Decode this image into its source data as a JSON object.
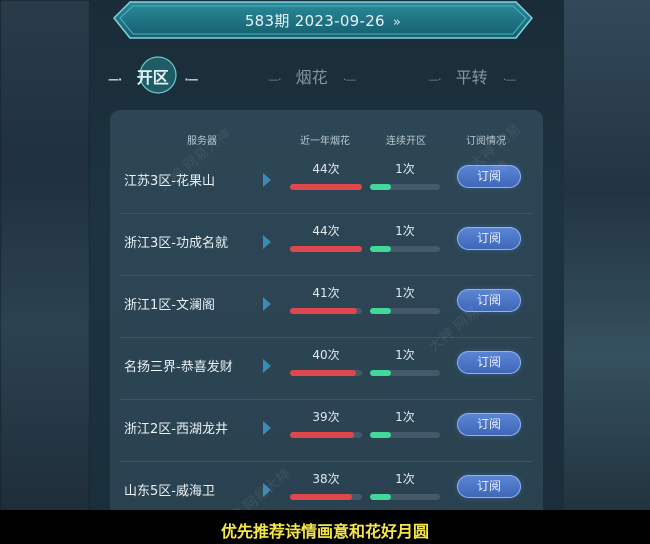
{
  "banner": {
    "label": "583期 2023-09-26",
    "arrow": "»"
  },
  "tabs": [
    {
      "label": "开区",
      "active": true
    },
    {
      "label": "烟花",
      "active": false
    },
    {
      "label": "平转",
      "active": false
    }
  ],
  "table": {
    "headers": {
      "server": "服务器",
      "fireworks": "近一年烟花",
      "consecutive": "连续开区",
      "subscribe": "订阅情况"
    },
    "rows": [
      {
        "server": "江苏3区-花果山",
        "fireworks": "44次",
        "fireworks_level": 1.0,
        "consecutive": "1次",
        "consecutive_level": 0.3,
        "action": "订阅"
      },
      {
        "server": "浙江3区-功成名就",
        "fireworks": "44次",
        "fireworks_level": 1.0,
        "consecutive": "1次",
        "consecutive_level": 0.3,
        "action": "订阅"
      },
      {
        "server": "浙江1区-文澜阁",
        "fireworks": "41次",
        "fireworks_level": 0.93,
        "consecutive": "1次",
        "consecutive_level": 0.3,
        "action": "订阅"
      },
      {
        "server": "名扬三界-恭喜发财",
        "fireworks": "40次",
        "fireworks_level": 0.91,
        "consecutive": "1次",
        "consecutive_level": 0.3,
        "action": "订阅"
      },
      {
        "server": "浙江2区-西湖龙井",
        "fireworks": "39次",
        "fireworks_level": 0.89,
        "consecutive": "1次",
        "consecutive_level": 0.3,
        "action": "订阅"
      },
      {
        "server": "山东5区-威海卫",
        "fireworks": "38次",
        "fireworks_level": 0.86,
        "consecutive": "1次",
        "consecutive_level": 0.3,
        "action": "订阅"
      }
    ]
  },
  "caption": "优先推荐诗情画意和花好月圆",
  "watermark": "大神 网易大神"
}
